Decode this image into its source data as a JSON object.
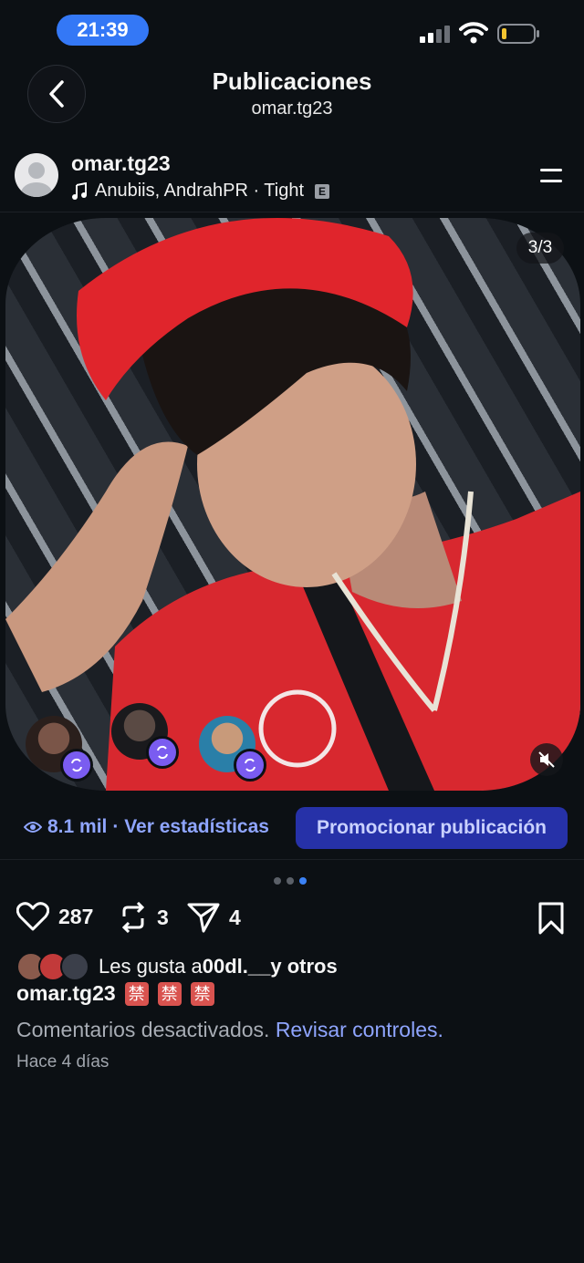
{
  "status_bar": {
    "time": "21:39"
  },
  "nav": {
    "title": "Publicaciones",
    "subtitle": "omar.tg23"
  },
  "post": {
    "username": "omar.tg23",
    "music": "Anubiis, AndrahPR · Tight",
    "explicit_badge": "E",
    "media_counter": "3/3",
    "views": "8.1 mil",
    "stats_link": "· Ver estadísticas",
    "promote_label": "Promocionar publicación",
    "likes_count": "287",
    "reposts_count": "3",
    "shares_count": "4",
    "likes_prefix": "Les gusta a ",
    "likes_user": "00dl.__",
    "likes_suffix": " y otros",
    "caption_user": "omar.tg23",
    "caption_emojis": [
      "禁",
      "禁",
      "禁"
    ],
    "comments_disabled": "Comentarios desactivados.",
    "review_controls": "Revisar controles.",
    "time_ago": "Hace 4 días"
  },
  "carousel": {
    "total": 3,
    "active": 3
  },
  "colors": {
    "accent": "#3478f6",
    "promote_bg": "#2631a8",
    "link": "#8fa5ff",
    "repost_badge": "#7a5cf0"
  }
}
